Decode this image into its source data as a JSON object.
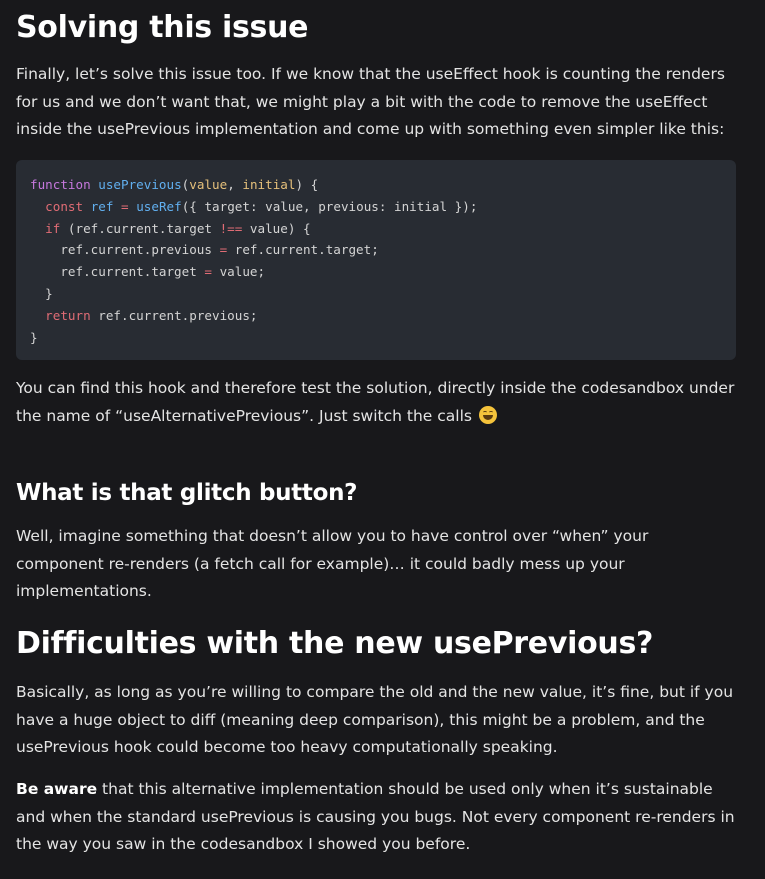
{
  "sections": {
    "solving": {
      "heading": "Solving this issue",
      "paragraph": "Finally, let’s solve this issue too. If we know that the useEffect hook is counting the renders for us and we don’t want that, we might play a bit with the code to remove the useEffect inside the usePrevious implementation and come up with something even simpler like this:",
      "after_code": "You can find this hook and therefore test the solution, directly inside the codesandbox under the name of “useAlternativePrevious”. Just switch the calls",
      "emoji": "grinning-face-emoji"
    },
    "glitch": {
      "heading": "What is that glitch button?",
      "paragraph": "Well, imagine something that doesn’t allow you to have control over “when” your component re-renders (a fetch call for example)… it could badly mess up your implementations."
    },
    "difficulties": {
      "heading": "Difficulties with the new usePrevious?",
      "paragraph": "Basically, as long as you’re willing to compare the old and the new value, it’s fine, but if you have a huge object to diff (meaning deep comparison), this might be a problem, and the usePrevious hook could become too heavy computationally speaking.",
      "aware_bold": "Be aware",
      "aware_rest": " that this alternative implementation should be used only when it’s sustainable and when the standard usePrevious is causing you bugs. Not every component re-renders in the way you saw in the codesandbox I showed you before."
    }
  },
  "code": {
    "lines": [
      [
        {
          "t": "function",
          "c": "kw"
        },
        {
          "t": " ",
          "c": "plain"
        },
        {
          "t": "usePrevious",
          "c": "fn"
        },
        {
          "t": "(",
          "c": "plain"
        },
        {
          "t": "value",
          "c": "param"
        },
        {
          "t": ", ",
          "c": "plain"
        },
        {
          "t": "initial",
          "c": "param"
        },
        {
          "t": ") {",
          "c": "plain"
        }
      ],
      [
        {
          "t": "  ",
          "c": "plain"
        },
        {
          "t": "const",
          "c": "kw2"
        },
        {
          "t": " ",
          "c": "plain"
        },
        {
          "t": "ref",
          "c": "fn"
        },
        {
          "t": " ",
          "c": "plain"
        },
        {
          "t": "=",
          "c": "op"
        },
        {
          "t": " ",
          "c": "plain"
        },
        {
          "t": "useRef",
          "c": "fn"
        },
        {
          "t": "({ target: value, previous: initial });",
          "c": "plain"
        }
      ],
      [
        {
          "t": "  ",
          "c": "plain"
        },
        {
          "t": "if",
          "c": "kw2"
        },
        {
          "t": " (ref.current.target ",
          "c": "plain"
        },
        {
          "t": "!==",
          "c": "op"
        },
        {
          "t": " value) {",
          "c": "plain"
        }
      ],
      [
        {
          "t": "    ref.current.previous ",
          "c": "plain"
        },
        {
          "t": "=",
          "c": "op"
        },
        {
          "t": " ref.current.target;",
          "c": "plain"
        }
      ],
      [
        {
          "t": "    ref.current.target ",
          "c": "plain"
        },
        {
          "t": "=",
          "c": "op"
        },
        {
          "t": " value;",
          "c": "plain"
        }
      ],
      [
        {
          "t": "  }",
          "c": "plain"
        }
      ],
      [
        {
          "t": "  ",
          "c": "plain"
        },
        {
          "t": "return",
          "c": "kw2"
        },
        {
          "t": " ref.current.previous;",
          "c": "plain"
        }
      ],
      [
        {
          "t": "}",
          "c": "plain"
        }
      ]
    ]
  }
}
